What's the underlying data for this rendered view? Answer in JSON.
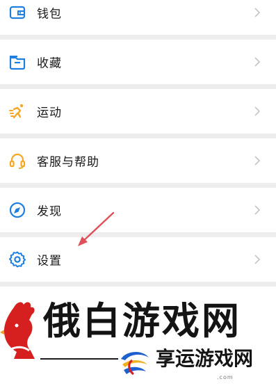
{
  "menu": {
    "items": [
      {
        "label": "钱包",
        "icon": "wallet-icon"
      },
      {
        "label": "收藏",
        "icon": "favorites-box-icon"
      },
      {
        "label": "运动",
        "icon": "running-icon"
      },
      {
        "label": "客服与帮助",
        "icon": "headset-icon"
      },
      {
        "label": "发现",
        "icon": "compass-icon"
      },
      {
        "label": "设置",
        "icon": "gear-icon"
      }
    ]
  },
  "colors": {
    "accent": "#1e7fe0",
    "warning": "#f5a623",
    "annotation_arrow": "#e0505a",
    "background": "#ededed"
  },
  "watermark": {
    "title": "俄白游戏网",
    "subtitle": "享运游戏网",
    "domain": ".com"
  }
}
